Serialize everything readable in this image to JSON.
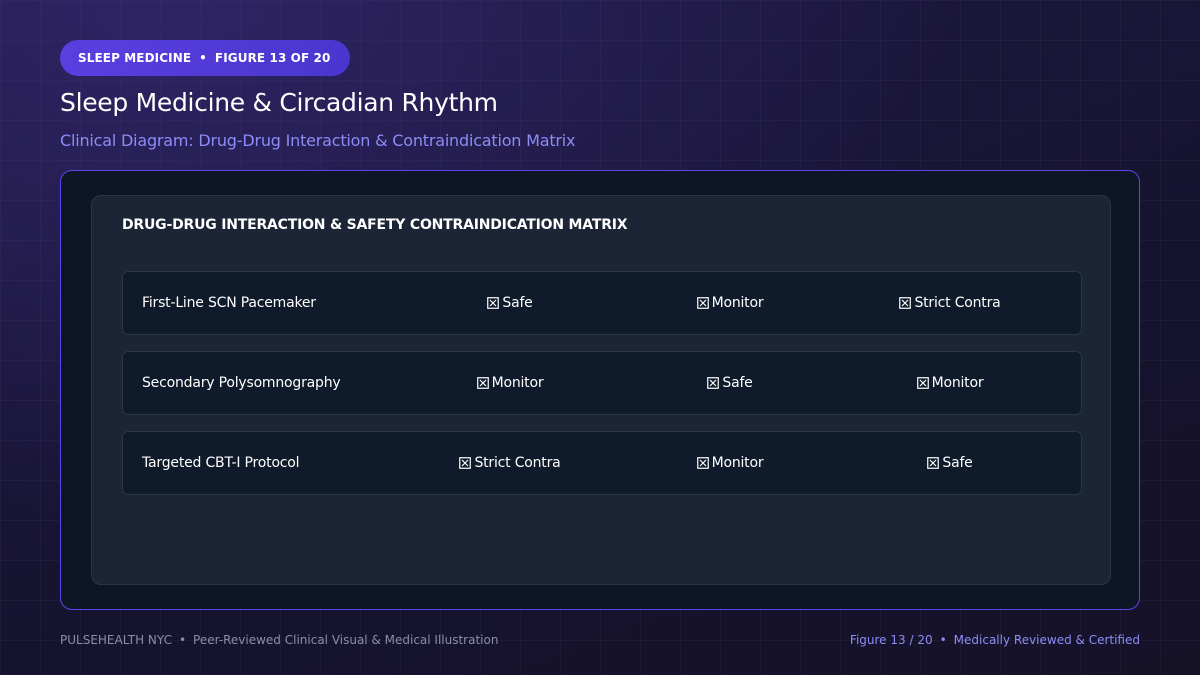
{
  "badge": {
    "category": "SLEEP MEDICINE",
    "separator": "•",
    "figure": "FIGURE 13 OF 20"
  },
  "header": {
    "title": "Sleep Medicine & Circadian Rhythm",
    "subtitle": "Clinical Diagram: Drug-Drug Interaction & Contraindication Matrix"
  },
  "matrix": {
    "title": "DRUG-DRUG INTERACTION & SAFETY CONTRAINDICATION MATRIX",
    "mark_icon": "boxed-x-icon",
    "rows": [
      {
        "label": "First-Line SCN Pacemaker",
        "cells": [
          "Safe",
          "Monitor",
          "Strict Contra"
        ]
      },
      {
        "label": "Secondary Polysomnography",
        "cells": [
          "Monitor",
          "Safe",
          "Monitor"
        ]
      },
      {
        "label": "Targeted CBT-I Protocol",
        "cells": [
          "Strict Contra",
          "Monitor",
          "Safe"
        ]
      }
    ]
  },
  "footer": {
    "brand": "PULSEHEALTH NYC",
    "separator": "•",
    "description": "Peer-Reviewed Clinical Visual & Medical Illustration",
    "figure_counter": "Figure 13 / 20",
    "certification": "Medically Reviewed & Certified"
  },
  "colors": {
    "accent": "#5a3fe0",
    "subtitle": "#8c8cf5",
    "frame_border": "#5a45e6"
  }
}
